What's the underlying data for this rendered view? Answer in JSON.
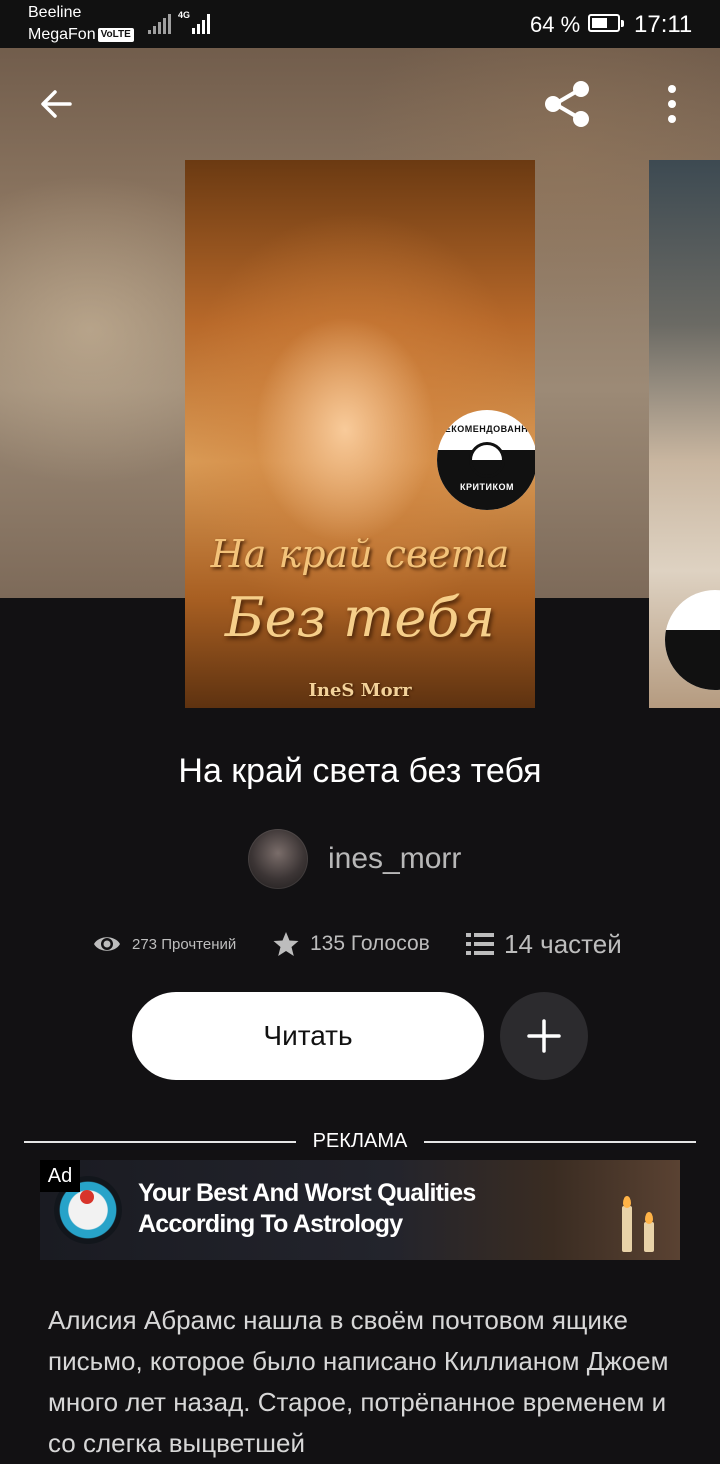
{
  "status_bar": {
    "carrier_1": "Beeline",
    "carrier_2": "MegaFon",
    "volte": "VoLTE",
    "network": "4G",
    "battery_percent": "64 %",
    "battery_level": 0.64,
    "time": "17:11"
  },
  "toolbar": {
    "back_icon": "arrow-left-icon",
    "share_icon": "share-icon",
    "more_icon": "more-vertical-icon"
  },
  "cover": {
    "title_line_1": "На край света",
    "title_line_2": "Без тебя",
    "author": "IneS Morr",
    "badge_top": "РЕКОМЕНДОВАННО",
    "badge_bottom": "КРИТИКОМ"
  },
  "book": {
    "title": "На край света без тебя",
    "author": "ines_morr"
  },
  "stats": {
    "reads": "273 Прочтений",
    "votes": "135 Голосов",
    "parts": "14 частей"
  },
  "actions": {
    "read_label": "Читать",
    "add_icon": "plus-icon"
  },
  "ad": {
    "section_label": "РЕКЛАМА",
    "tag": "Ad",
    "headline": "Your Best And Worst Qualities According To Astrology"
  },
  "description": "Алисия Абрамс нашла в своём почтовом ящике письмо, которое было написано Киллианом Джоем много лет назад. Старое, потрёпанное временем и со слегка выцветшей"
}
